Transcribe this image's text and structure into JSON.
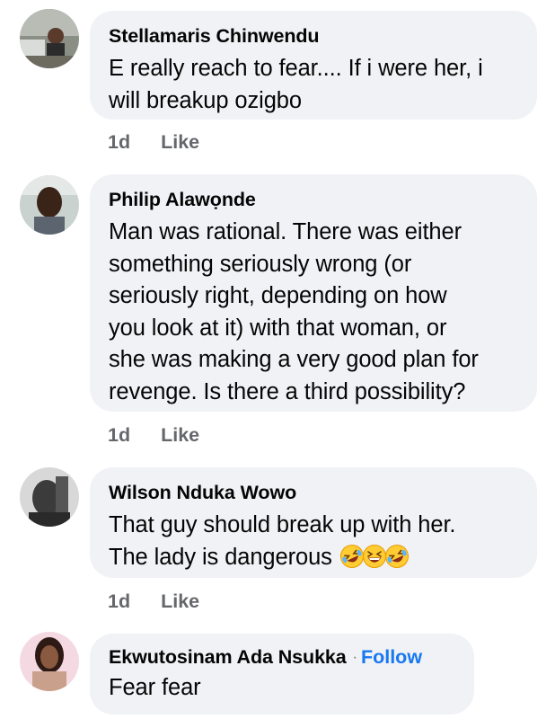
{
  "comments": [
    {
      "author": "Stellamaris Chinwendu",
      "lines": [
        "E really reach to fear.... If i were her, i",
        "will breakup ozigbo"
      ],
      "time": "1d",
      "like": "Like",
      "avatar_icon": "user-photo-avatar"
    },
    {
      "author": "Philip Alawọnde",
      "lines": [
        "Man was rational. There was either",
        "something seriously wrong (or",
        "seriously right, depending on how",
        "you look at it) with that woman, or",
        "she was making a very good plan for",
        "revenge. Is there a third possibility?"
      ],
      "time": "1d",
      "like": "Like",
      "avatar_icon": "user-photo-avatar"
    },
    {
      "author": "Wilson Nduka Wowo",
      "lines": [
        "That guy should break up with her.",
        "The lady is dangerous"
      ],
      "emojis": [
        "rolling-laughing-emoji",
        "grinning-squint-emoji",
        "rolling-laughing-emoji"
      ],
      "time": "1d",
      "like": "Like",
      "avatar_icon": "user-photo-avatar"
    },
    {
      "author": "Ekwutosinam Ada Nsukka",
      "dot": "·",
      "follow": "Follow",
      "lines": [
        "Fear fear"
      ],
      "avatar_icon": "user-photo-avatar"
    }
  ],
  "colors": {
    "bubble": "#f0f2f5",
    "meta_text": "#65676b",
    "follow": "#1877f2",
    "text": "#050505"
  }
}
